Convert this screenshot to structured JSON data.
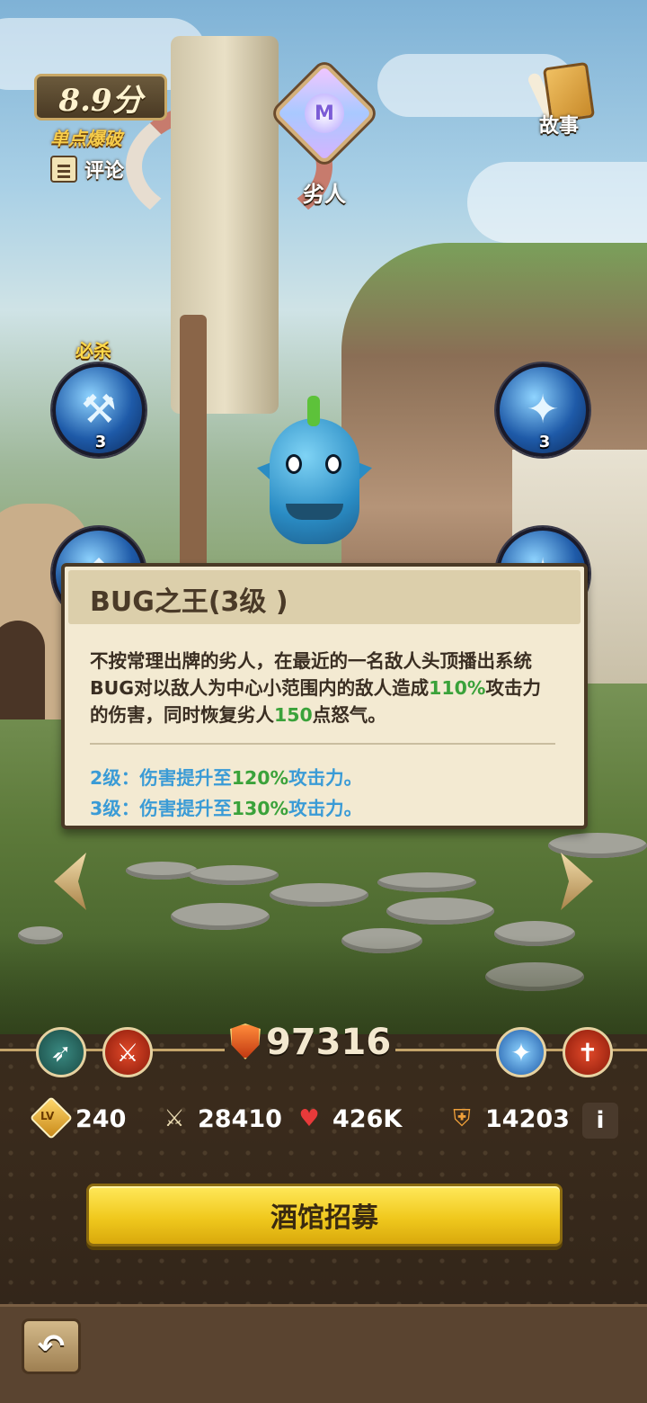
{
  "header": {
    "score": "8.9分",
    "tag": "单点爆破",
    "comment_label": "评论",
    "rank_label": "劣人",
    "story_label": "故事"
  },
  "skills": {
    "ult_label": "必杀",
    "top_left_level": "3",
    "top_right_level": "3"
  },
  "tooltip": {
    "title": "BUG之王(3级 )",
    "desc_part1": "不按常理出牌的劣人，在最近的一名敌人头顶播出系统BUG对以敌人为中心小范围内的敌人造成",
    "desc_hl1": "110%",
    "desc_part2": "攻击力的伤害，同时恢复劣人",
    "desc_hl2": "150",
    "desc_part3": "点怒气。",
    "level2_prefix": "2级：伤害提升至",
    "level2_value": "120%",
    "level2_suffix": "攻击力。",
    "level3_prefix": "3级：伤害提升至",
    "level3_value": "130%",
    "level3_suffix": "攻击力。"
  },
  "stats": {
    "power": "97316",
    "level_icon_text": "LV",
    "level": "240",
    "attack": "28410",
    "hp": "426K",
    "defense": "14203",
    "info_label": "i"
  },
  "actions": {
    "recruit_label": "酒馆招募",
    "back_label": "↶"
  },
  "colors": {
    "highlight_green": "#3aa23a",
    "level_blue": "#3a9bd6",
    "recruit_yellow": "#f0c91e"
  }
}
